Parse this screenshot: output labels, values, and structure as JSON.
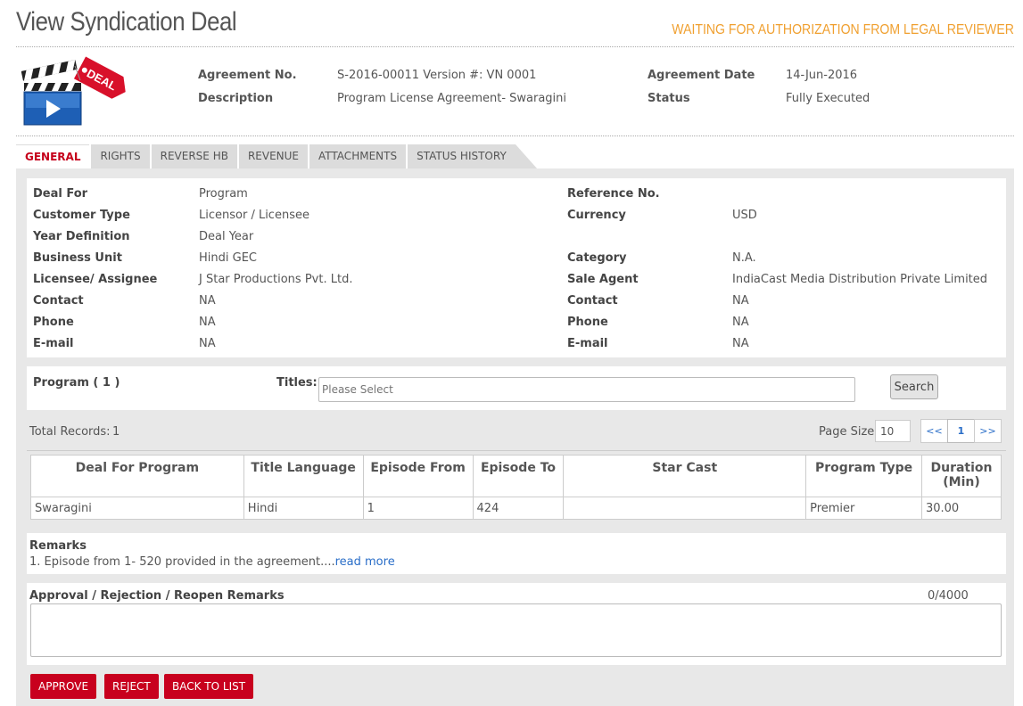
{
  "page_title": "View Syndication Deal",
  "status_banner": "WAITING FOR AUTHORIZATION FROM LEGAL REVIEWER",
  "header": {
    "icon_tag": "DEAL",
    "agreement_no_label": "Agreement No.",
    "agreement_no_value": "S-2016-00011 Version #: VN 0001",
    "agreement_date_label": "Agreement Date",
    "agreement_date_value": "14-Jun-2016",
    "description_label": "Description",
    "description_value": "Program License Agreement- Swaragini",
    "status_label": "Status",
    "status_value": "Fully Executed"
  },
  "tabs": [
    {
      "label": "GENERAL",
      "active": true
    },
    {
      "label": "RIGHTS"
    },
    {
      "label": "REVERSE HB"
    },
    {
      "label": "REVENUE"
    },
    {
      "label": "ATTACHMENTS"
    },
    {
      "label": "STATUS HISTORY"
    }
  ],
  "general": {
    "left": [
      {
        "label": "Deal For",
        "value": "Program"
      },
      {
        "label": "Customer Type",
        "value": "Licensor / Licensee"
      },
      {
        "label": "Year Definition",
        "value": "Deal Year"
      },
      {
        "label": "Business Unit",
        "value": "Hindi GEC"
      },
      {
        "label": "Licensee/ Assignee",
        "value": "J Star Productions Pvt. Ltd."
      },
      {
        "label": "Contact",
        "value": "NA"
      },
      {
        "label": "Phone",
        "value": "NA"
      },
      {
        "label": "E-mail",
        "value": "NA"
      }
    ],
    "right": [
      {
        "label": "Reference No.",
        "value": ""
      },
      {
        "label": "Currency",
        "value": "USD"
      },
      {
        "label": "",
        "value": ""
      },
      {
        "label": "Category",
        "value": "N.A."
      },
      {
        "label": "Sale Agent",
        "value": "IndiaCast Media Distribution Private Limited"
      },
      {
        "label": "Contact",
        "value": "NA"
      },
      {
        "label": "Phone",
        "value": "NA"
      },
      {
        "label": "E-mail",
        "value": "NA"
      }
    ]
  },
  "program": {
    "label": "Program ( 1 )",
    "titles_label": "Titles:",
    "titles_placeholder": "Please Select",
    "search_label": "Search"
  },
  "records": {
    "total_label": "Total Records:",
    "total_value": "1",
    "page_size_label": "Page Size:",
    "page_size_value": "10",
    "pager_prev": "<<",
    "pager_current": "1",
    "pager_next": ">>"
  },
  "table": {
    "headers": [
      "Deal For Program",
      "Title Language",
      "Episode From",
      "Episode To",
      "Star Cast",
      "Program Type",
      "Duration (Min)"
    ],
    "rows": [
      [
        "Swaragini",
        "Hindi",
        "1",
        "424",
        "",
        "Premier",
        "30.00"
      ]
    ]
  },
  "remarks": {
    "label": "Remarks",
    "text": "1. Episode from 1- 520 provided in the agreement....",
    "link": "read more"
  },
  "approval": {
    "label": "Approval / Rejection / Reopen Remarks",
    "counter": "0/4000",
    "value": ""
  },
  "actions": {
    "approve": "APPROVE",
    "reject": "REJECT",
    "back": "BACK TO LIST"
  },
  "colors": {
    "accent_red": "#c8001e",
    "banner_orange": "#f0a030",
    "link_blue": "#2a6ec8",
    "panel_gray": "#e8e8e8"
  }
}
